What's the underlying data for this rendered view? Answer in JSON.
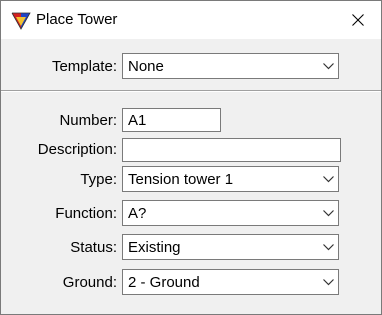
{
  "window": {
    "title": "Place Tower",
    "icon": "triangle-app-icon",
    "close_icon": "close-icon"
  },
  "form": {
    "template": {
      "label": "Template:",
      "value": "None"
    },
    "number": {
      "label": "Number:",
      "value": "A1"
    },
    "description": {
      "label": "Description:",
      "value": ""
    },
    "type": {
      "label": "Type:",
      "value": "Tension tower 1"
    },
    "function": {
      "label": "Function:",
      "value": "A?"
    },
    "status": {
      "label": "Status:",
      "value": "Existing"
    },
    "ground": {
      "label": "Ground:",
      "value": "2 - Ground"
    }
  },
  "colors": {
    "window_bg": "#f0f0f0",
    "titlebar_bg": "#ffffff",
    "field_border": "#7a7a7a"
  }
}
